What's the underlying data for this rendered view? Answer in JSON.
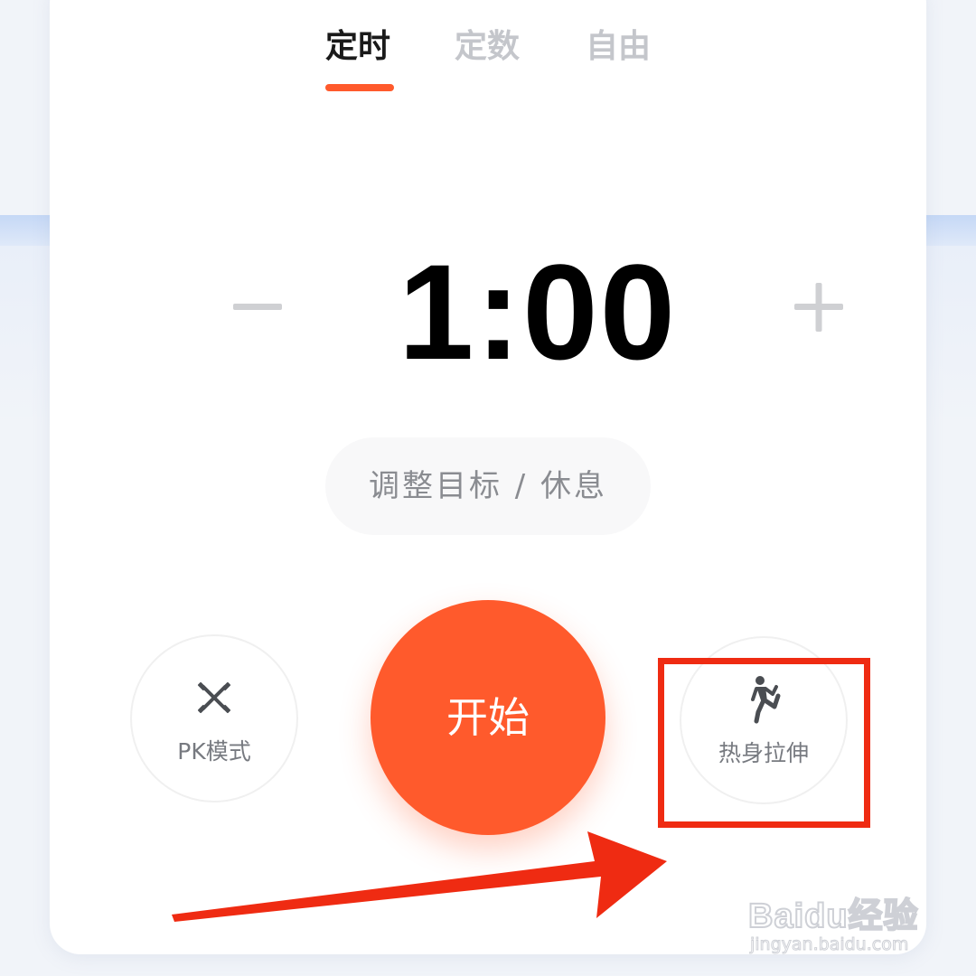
{
  "tabs": [
    {
      "label": "定时",
      "active": true
    },
    {
      "label": "定数",
      "active": false
    },
    {
      "label": "自由",
      "active": false
    }
  ],
  "timer": {
    "value": "1:00"
  },
  "adjust_button": {
    "label": "调整目标 / 休息"
  },
  "start_button": {
    "label": "开始"
  },
  "pk_button": {
    "label": "PK模式",
    "icon": "crossed-dumbbells-icon"
  },
  "warmup_button": {
    "label": "热身拉伸",
    "icon": "running-person-icon"
  },
  "watermark": {
    "logo": "Baidu经验",
    "url": "jingyan.baidu.com"
  },
  "colors": {
    "accent": "#ff5a2c",
    "annotation": "#ef2b12",
    "inactive_tab": "#c4c6cb",
    "background": "#f1f4f9"
  }
}
